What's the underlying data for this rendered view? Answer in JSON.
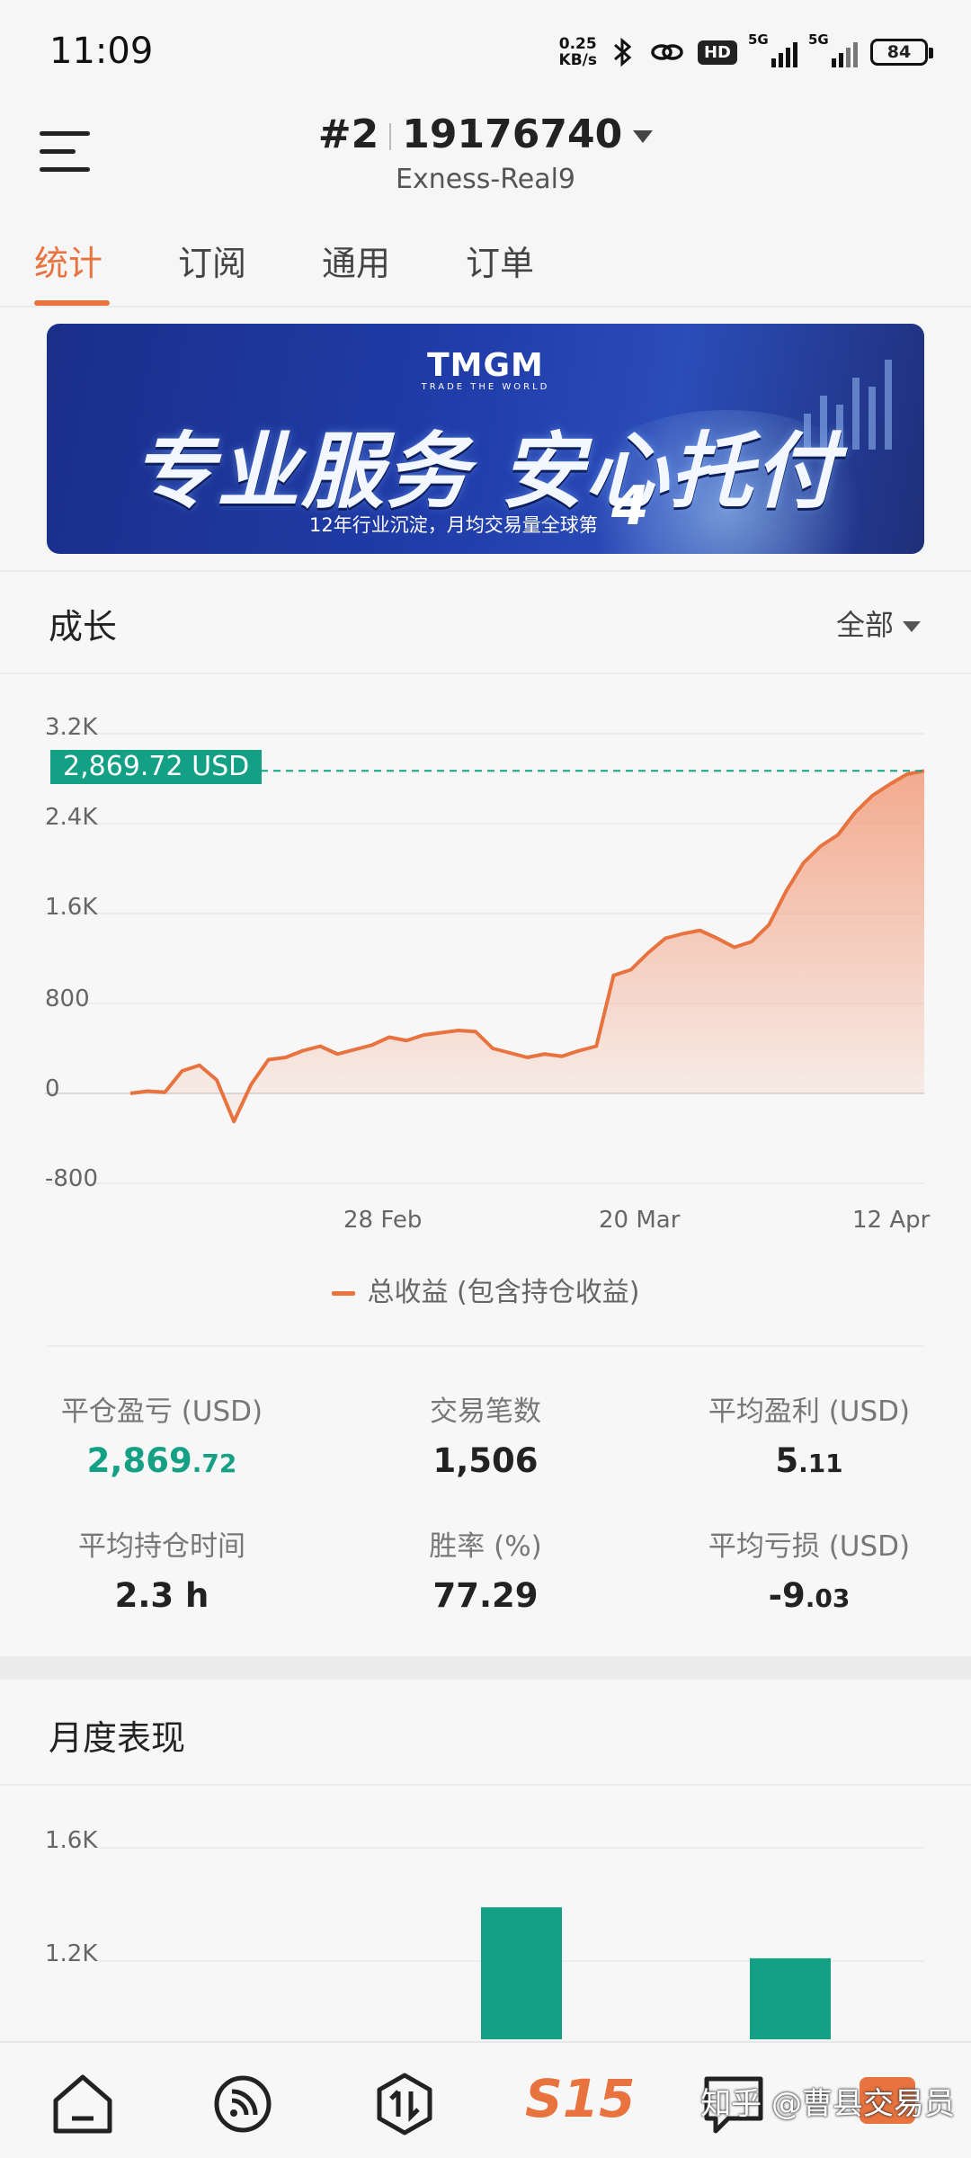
{
  "status_bar": {
    "time": "11:09",
    "net_speed_value": "0.25",
    "net_speed_unit": "KB/s",
    "hd_label": "HD",
    "signal1_label": "5G",
    "signal2_label": "5G",
    "battery": "84"
  },
  "header": {
    "account_index": "#2",
    "account_number": "19176740",
    "server": "Exness-Real9"
  },
  "tabs": [
    {
      "label": "统计",
      "active": true
    },
    {
      "label": "订阅",
      "active": false
    },
    {
      "label": "通用",
      "active": false
    },
    {
      "label": "订单",
      "active": false
    }
  ],
  "banner": {
    "logo": "TMGM",
    "logo_tagline": "TRADE THE WORLD",
    "slogan": "专业服务 安心托付",
    "subtitle": "12年行业沉淀，月均交易量全球第",
    "rank": "4"
  },
  "growth": {
    "title": "成长",
    "filter": "全部",
    "current_value_label": "2,869.72 USD",
    "legend": "总收益 (包含持仓收益)"
  },
  "chart_data": {
    "type": "area",
    "title": "",
    "xlabel": "",
    "ylabel": "",
    "y_ticks": [
      "3.2K",
      "2.4K",
      "1.6K",
      "800",
      "0",
      "-800"
    ],
    "x_ticks": [
      "28 Feb",
      "20 Mar",
      "12 Apr"
    ],
    "ylim": [
      -800,
      3200
    ],
    "current_value": 2869.72,
    "series": [
      {
        "name": "总收益 (包含持仓收益)",
        "color": "#e8733f",
        "values": [
          0,
          20,
          10,
          200,
          250,
          120,
          -250,
          80,
          300,
          320,
          380,
          420,
          350,
          390,
          430,
          500,
          470,
          520,
          540,
          560,
          550,
          400,
          360,
          320,
          350,
          330,
          380,
          420,
          1050,
          1100,
          1250,
          1380,
          1420,
          1450,
          1380,
          1300,
          1350,
          1500,
          1800,
          2050,
          2200,
          2300,
          2500,
          2650,
          2750,
          2840,
          2869.72
        ]
      }
    ]
  },
  "stats": {
    "closed_pnl_label": "平仓盈亏 (USD)",
    "closed_pnl_int": "2,869",
    "closed_pnl_dec": ".72",
    "trades_label": "交易笔数",
    "trades_value": "1,506",
    "avg_profit_label": "平均盈利 (USD)",
    "avg_profit_int": "5",
    "avg_profit_dec": ".11",
    "avg_hold_label": "平均持仓时间",
    "avg_hold_value": "2.3 h",
    "win_rate_label": "胜率 (%)",
    "win_rate_value": "77.29",
    "avg_loss_label": "平均亏损 (USD)",
    "avg_loss_int": "-9",
    "avg_loss_dec": ".03"
  },
  "monthly": {
    "title": "月度表现",
    "y_ticks": [
      "1.6K",
      "1.2K"
    ],
    "bar_color": "#14a085",
    "bars": [
      {
        "value": 1390
      },
      {
        "value": 1210
      }
    ]
  },
  "bottom_nav": {
    "center_label": "S15",
    "watermark": "知乎 @曹县交易员",
    "items": [
      "home-icon",
      "feed-icon",
      "market-icon",
      "chat-icon",
      "profile-icon"
    ]
  }
}
